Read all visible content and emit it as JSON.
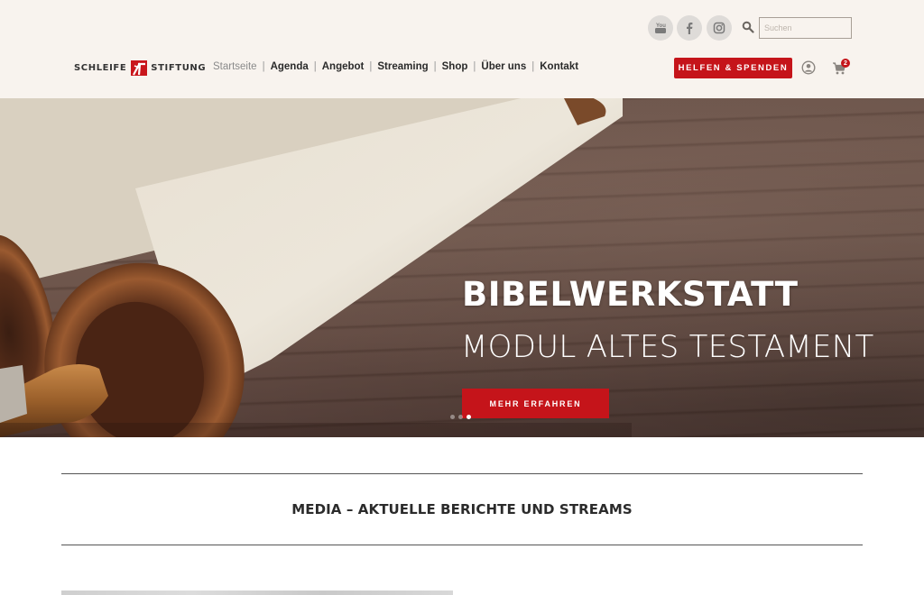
{
  "header": {
    "social": [
      {
        "name": "youtube",
        "icon": "youtube-icon"
      },
      {
        "name": "facebook",
        "icon": "facebook-icon"
      },
      {
        "name": "instagram",
        "icon": "instagram-icon"
      }
    ],
    "search": {
      "placeholder": "Suchen",
      "value": ""
    },
    "logo": {
      "left": "SCHLEIFE",
      "right": "STIFTUNG"
    },
    "nav": [
      {
        "label": "Startseite",
        "active": true
      },
      {
        "label": "Agenda",
        "active": false
      },
      {
        "label": "Angebot",
        "active": false
      },
      {
        "label": "Streaming",
        "active": false
      },
      {
        "label": "Shop",
        "active": false
      },
      {
        "label": "Über uns",
        "active": false
      },
      {
        "label": "Kontakt",
        "active": false
      }
    ],
    "nav_separator": "|",
    "donate_label": "HELFEN & SPENDEN",
    "cart_count": "2"
  },
  "hero": {
    "title": "BIBELWERKSTATT",
    "subtitle": "MODUL ALTES TESTAMENT",
    "cta_label": "MEHR ERFAHREN",
    "slides_total": 3,
    "active_slide": 3
  },
  "section": {
    "title": "MEDIA – AKTUELLE BERICHTE UND STREAMS"
  },
  "colors": {
    "brand_red": "#c5141a",
    "header_bg": "#f8f3ee"
  }
}
